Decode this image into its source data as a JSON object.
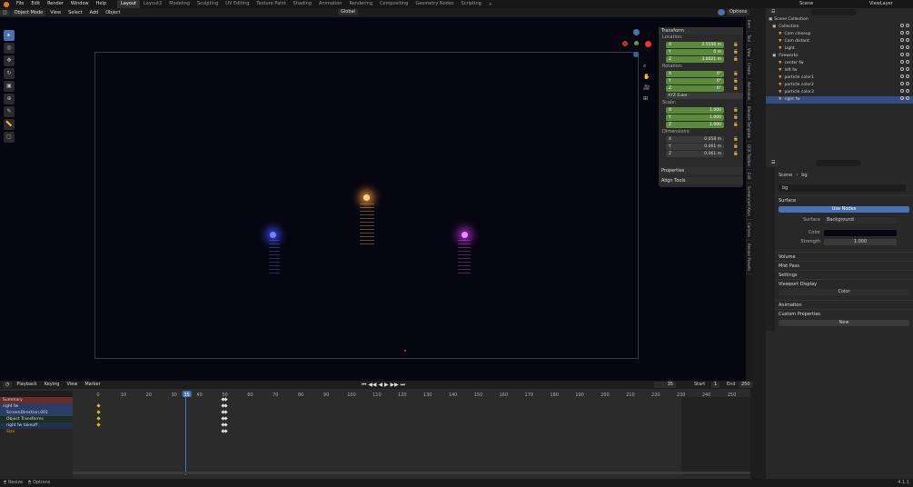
{
  "menu": [
    "File",
    "Edit",
    "Render",
    "Window",
    "Help"
  ],
  "tabs": [
    "Layout",
    "Layout2",
    "Modeling",
    "Sculpting",
    "UV Editing",
    "Texture Paint",
    "Shading",
    "Animation",
    "Rendering",
    "Compositing",
    "Geometry Nodes",
    "Scripting"
  ],
  "active_tab": "Layout",
  "scene_name": "Scene",
  "view_layer": "ViewLayer",
  "header": {
    "mode": "Object Mode",
    "view": "View",
    "select": "Select",
    "add": "Add",
    "object": "Object",
    "transform": "Global",
    "options": "Options"
  },
  "npanel": {
    "title": "Transform",
    "location": "Location:",
    "loc": [
      {
        "a": "X",
        "v": "2.5556 m"
      },
      {
        "a": "Y",
        "v": "0 m"
      },
      {
        "a": "Z",
        "v": "3.0021 m"
      }
    ],
    "rotation": "Rotation:",
    "rot": [
      {
        "a": "X",
        "v": "0°"
      },
      {
        "a": "Y",
        "v": "0°"
      },
      {
        "a": "Z",
        "v": "0°"
      }
    ],
    "rotmode": "XYZ Euler",
    "scale": "Scale:",
    "scl": [
      {
        "a": "X",
        "v": "1.000"
      },
      {
        "a": "Y",
        "v": "1.000"
      },
      {
        "a": "Z",
        "v": "1.000"
      }
    ],
    "dimensions": "Dimensions:",
    "dim": [
      {
        "a": "X",
        "v": "0.058 m"
      },
      {
        "a": "Y",
        "v": "0.061 m"
      },
      {
        "a": "Z",
        "v": "0.061 m"
      }
    ],
    "properties": "Properties",
    "align": "Align Tools"
  },
  "vtabs": [
    "Item",
    "Tool",
    "View",
    "Create",
    "Animation",
    "Blender Template",
    "QCK Toolbar",
    "Edit",
    "Screencast Keys",
    "Camera",
    "Render Presets"
  ],
  "timeline": {
    "playback": "Playback",
    "keying": "Keying",
    "view": "View",
    "marker": "Marker",
    "frame": "35",
    "start_label": "Start",
    "start": "1",
    "end_label": "End",
    "end": "250"
  },
  "ruler": [
    "0",
    "10",
    "20",
    "30",
    "35",
    "40",
    "50",
    "60",
    "70",
    "80",
    "90",
    "100",
    "110",
    "120",
    "130",
    "140",
    "150",
    "160",
    "170",
    "180",
    "190",
    "200",
    "210",
    "220",
    "230",
    "240",
    "250"
  ],
  "tracks": [
    "Summary",
    "right fw",
    "ScreenDirection.001",
    "Object Transforms",
    "right fw takeoff",
    "Size"
  ],
  "outliner": {
    "root": "Scene Collection",
    "items": [
      {
        "name": "Collection",
        "lvl": 1
      },
      {
        "name": "Cam closeup",
        "lvl": 2
      },
      {
        "name": "Cam distant",
        "lvl": 2
      },
      {
        "name": "Light",
        "lvl": 2
      },
      {
        "name": "Fireworks",
        "lvl": 1
      },
      {
        "name": "center fw",
        "lvl": 2
      },
      {
        "name": "left fw",
        "lvl": 2
      },
      {
        "name": "particle color1",
        "lvl": 2
      },
      {
        "name": "particle color2",
        "lvl": 2
      },
      {
        "name": "particle color3",
        "lvl": 2
      },
      {
        "name": "right fw",
        "lvl": 2
      }
    ],
    "selected": "right fw"
  },
  "props": {
    "breadcrumb1": "Scene",
    "breadcrumb2": "bg",
    "world": "bg",
    "surface": "Surface",
    "use_nodes": "Use Nodes",
    "surface_label": "Surface",
    "surface_val": "Background",
    "color_label": "Color",
    "strength_label": "Strength",
    "strength": "1.000",
    "volume": "Volume",
    "mist": "Mist Pass",
    "settings": "Settings",
    "viewport_display": "Viewport Display",
    "vd_color": "Color",
    "animation": "Animation",
    "custom": "Custom Properties",
    "new": "New"
  },
  "status": {
    "resize": "Resize",
    "options": "Options",
    "version": "4.1.1"
  },
  "colors": {
    "accent": "#4772b3",
    "blue_fw": "#4d6bff",
    "orange_fw": "#ffbb66",
    "magenta_fw": "#ee44ff"
  }
}
